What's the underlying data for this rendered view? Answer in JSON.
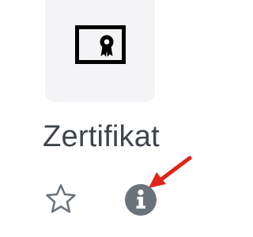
{
  "activity": {
    "title": "Zertifikat",
    "icon": "certificate-icon"
  },
  "actions": {
    "star_icon": "star-outline-icon",
    "info_icon": "info-icon"
  },
  "annotation": {
    "arrow_color": "#e0231b"
  },
  "colors": {
    "tile_background": "#f4f4f6",
    "icon_color": "#000000",
    "text_color": "#3f444b",
    "action_icon_color": "#6a737b"
  }
}
